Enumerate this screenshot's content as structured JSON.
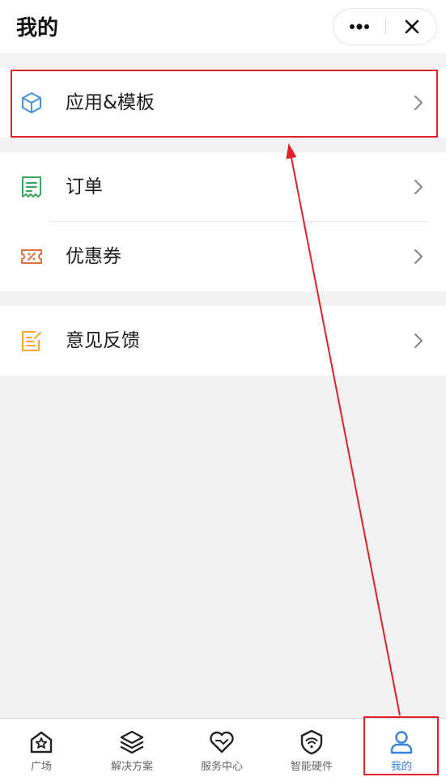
{
  "header": {
    "title": "我的",
    "more_icon": "more-dots-icon",
    "close_icon": "close-icon"
  },
  "menu": {
    "groups": [
      {
        "items": [
          {
            "label": "应用&模板",
            "icon": "cube-icon",
            "icon_color": "#4a90d9"
          }
        ]
      },
      {
        "items": [
          {
            "label": "订单",
            "icon": "receipt-icon",
            "icon_color": "#3aa55a"
          },
          {
            "label": "优惠券",
            "icon": "coupon-icon",
            "icon_color": "#e07040"
          }
        ]
      },
      {
        "items": [
          {
            "label": "意见反馈",
            "icon": "feedback-icon",
            "icon_color": "#f0a830"
          }
        ]
      }
    ]
  },
  "tabbar": {
    "tabs": [
      {
        "label": "广场",
        "icon": "home-star-icon",
        "active": false
      },
      {
        "label": "解决方案",
        "icon": "layers-icon",
        "active": false
      },
      {
        "label": "服务中心",
        "icon": "heart-service-icon",
        "active": false
      },
      {
        "label": "智能硬件",
        "icon": "wifi-shield-icon",
        "active": false
      },
      {
        "label": "我的",
        "icon": "user-icon",
        "active": true
      }
    ],
    "active_color": "#3b82e0"
  },
  "annotation": {
    "color": "#e0202a"
  }
}
